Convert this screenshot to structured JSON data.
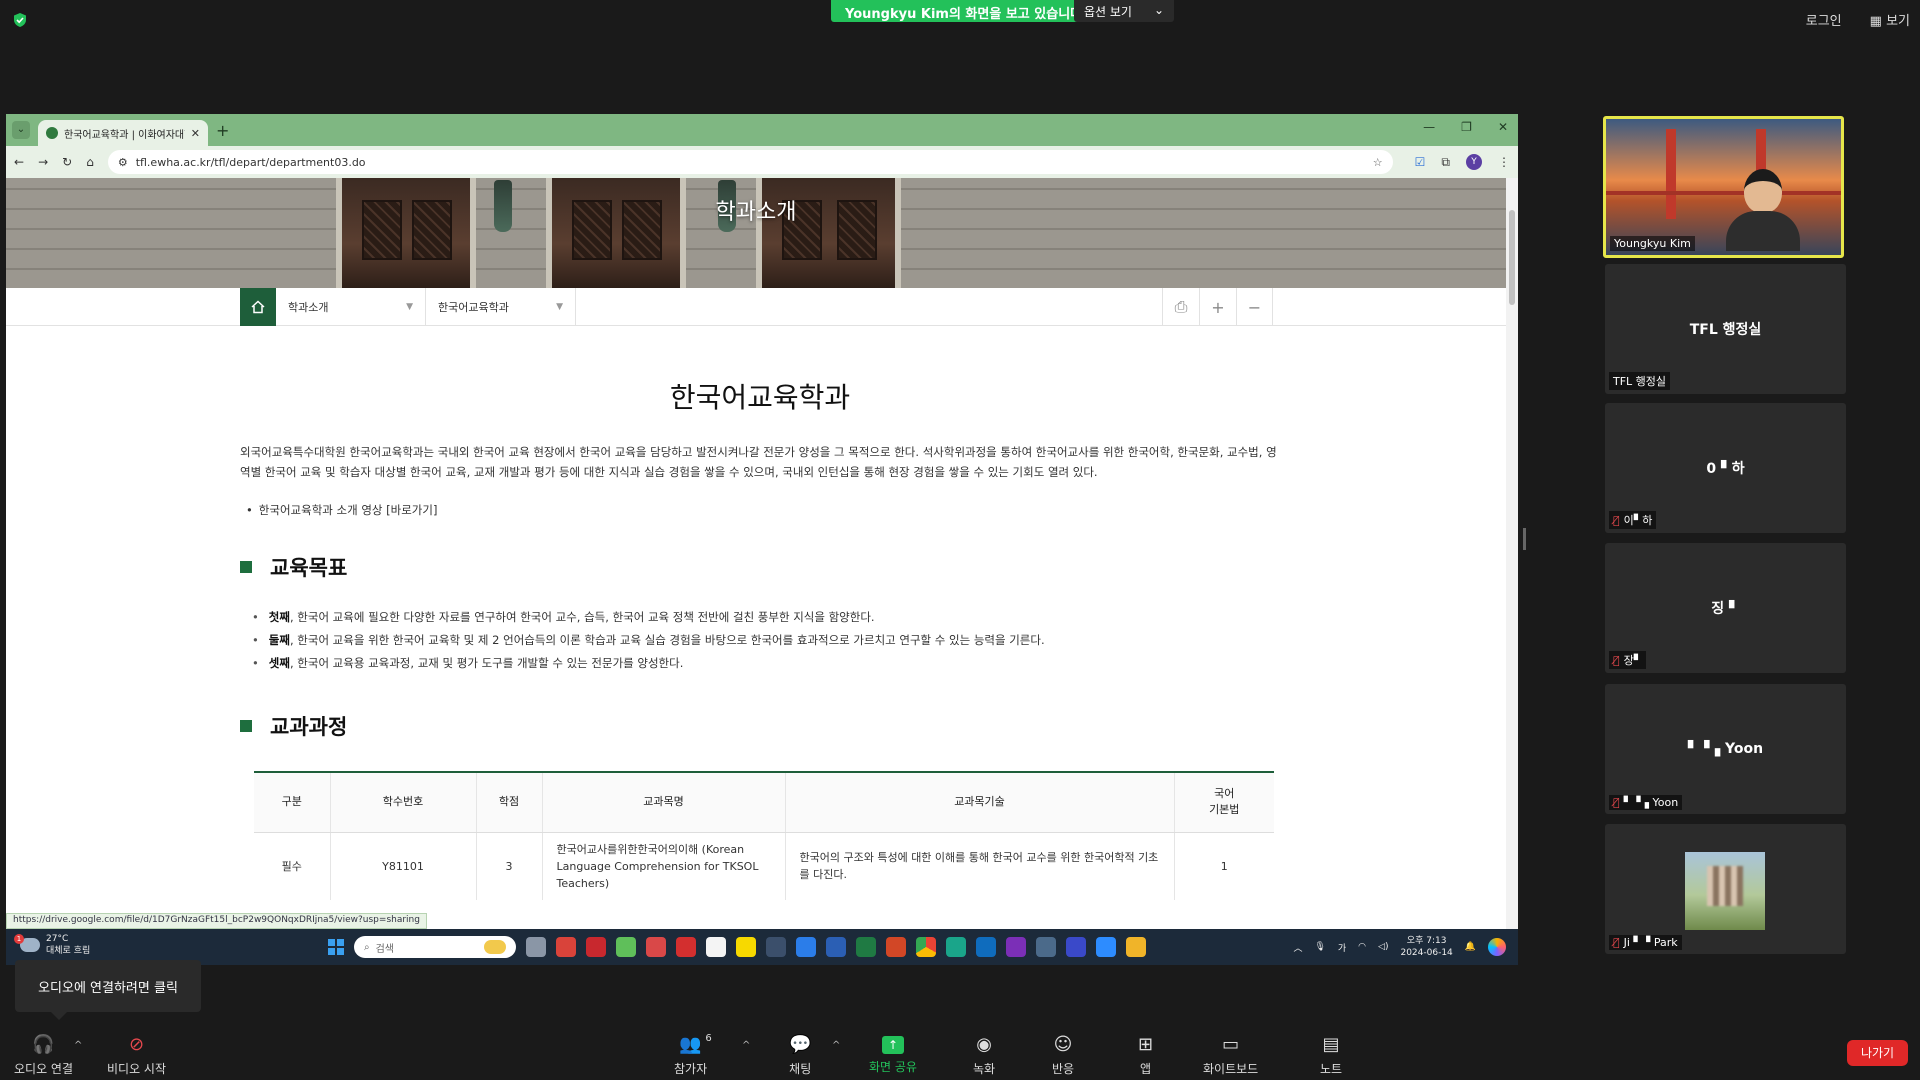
{
  "zoom": {
    "share_banner": "Youngkyu  Kim의 화면을 보고 있습니다",
    "view_options": "옵션 보기",
    "login": "로그인",
    "view": "보기",
    "audio_tooltip": "오디오에 연결하려면 클릭",
    "toolbar": {
      "audio": "오디오 연결",
      "video": "비디오 시작",
      "participants": "참가자",
      "participants_count": "6",
      "chat": "채팅",
      "share": "화면 공유",
      "record": "녹화",
      "reactions": "반응",
      "apps": "앱",
      "whiteboard": "화이트보드",
      "notes": "노트",
      "leave": "나가기"
    },
    "participants": [
      {
        "name": "Youngkyu Kim",
        "center": "",
        "muted": false
      },
      {
        "name": "TFL 행정실",
        "center": "TFL 행정실",
        "muted": false
      },
      {
        "name": "이▘하",
        "center": "0 ▘하",
        "muted": true
      },
      {
        "name": "장▘",
        "center": "징 ▘",
        "muted": true
      },
      {
        "name": "▘▝▗ Yoon",
        "center": "▘▝▗ Yoon",
        "muted": true
      },
      {
        "name": "Ji ▘▝ Park",
        "center": "",
        "muted": true
      }
    ]
  },
  "browser": {
    "tab_title": "한국어교육학과 | 이화여자대학",
    "url": "tfl.ewha.ac.kr/tfl/depart/department03.do",
    "status_url": "https://drive.google.com/file/d/1D7GrNzaGFt15l_bcP2w9QONqxDRIjna5/view?usp=sharing",
    "avatar_letter": "Y"
  },
  "page": {
    "hero_title": "학과소개",
    "crumb1": "학과소개",
    "crumb2": "한국어교육학과",
    "title": "한국어교육학과",
    "intro": "외국어교육특수대학원 한국어교육학과는 국내외 한국어 교육 현장에서 한국어 교육을 담당하고 발전시켜나갈 전문가 양성을 그 목적으로 한다. 석사학위과정을 통하여 한국어교사를 위한 한국어학, 한국문화, 교수법, 영역별 한국어 교육 및 학습자 대상별 한국어 교육, 교재 개발과 평가 등에 대한 지식과 실습 경험을 쌓을 수 있으며, 국내외 인턴십을 통해 현장 경험을 쌓을 수 있는 기회도 열려 있다.",
    "video_link": "한국어교육학과 소개 영상 [바로가기]",
    "goals_heading": "교육목표",
    "goals": [
      {
        "bold": "첫째",
        "text": ", 한국어 교육에 필요한 다양한 자료를 연구하여 한국어 교수, 습득, 한국어 교육 정책 전반에 걸친 풍부한 지식을 함양한다."
      },
      {
        "bold": "둘째",
        "text": ", 한국어 교육을 위한 한국어 교육학 및 제 2 언어습득의 이론 학습과 교육 실습 경험을 바탕으로 한국어를 효과적으로 가르치고 연구할 수 있는 능력을 기른다."
      },
      {
        "bold": "셋째",
        "text": ", 한국어 교육용 교육과정, 교재 및 평가 도구를 개발할 수 있는 전문가를 양성한다."
      }
    ],
    "curriculum_heading": "교과과정",
    "table": {
      "headers": [
        "구분",
        "학수번호",
        "학점",
        "교과목명",
        "교과목기술",
        "국어\n기본법"
      ],
      "rows": [
        [
          "필수",
          "Y81101",
          "3",
          "한국어교사를위한한국어의이해 (Korean Language Comprehension for TKSOL Teachers)",
          "한국어의 구조와 특성에 대한 이해를 통해 한국어 교수를 위한 한국어학적 기초를 다진다.",
          "1"
        ]
      ]
    }
  },
  "taskbar": {
    "temp": "27°C",
    "weather": "대체로 흐림",
    "weather_badge": "1",
    "search": "검색",
    "ime": "가",
    "time": "오후 7:13",
    "date": "2024-06-14"
  }
}
